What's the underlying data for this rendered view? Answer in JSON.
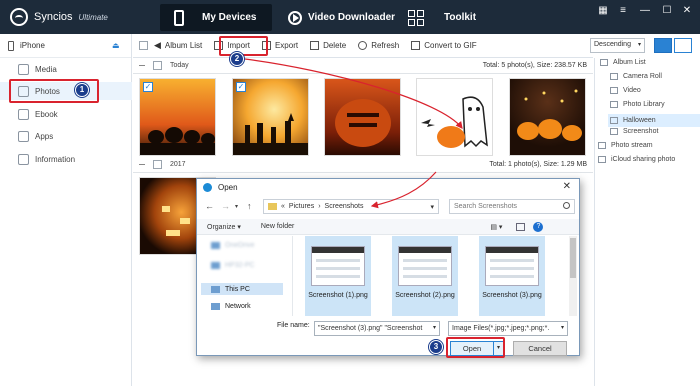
{
  "app": {
    "name": "Syncios",
    "edition": "Ultimate"
  },
  "nav": {
    "devices": "My Devices",
    "video": "Video Downloader",
    "toolkit": "Toolkit"
  },
  "window_controls": [
    "▦",
    "≡",
    "—",
    "☐",
    "✕"
  ],
  "device": {
    "name": "iPhone",
    "eject": "⏏"
  },
  "sidebar": {
    "items": [
      {
        "label": "Media",
        "icon": "media-icon"
      },
      {
        "label": "Photos",
        "icon": "photos-icon"
      },
      {
        "label": "Ebook",
        "icon": "ebook-icon"
      },
      {
        "label": "Apps",
        "icon": "apps-icon"
      },
      {
        "label": "Information",
        "icon": "info-icon"
      }
    ]
  },
  "toolbar": {
    "album_list": "Album List",
    "import": "Import",
    "export": "Export",
    "delete": "Delete",
    "refresh": "Refresh",
    "convert": "Convert to GIF",
    "sort": "Descending",
    "sort_arrow": "▾"
  },
  "groups": [
    {
      "label": "Today",
      "total": "Total: 5 photo(s), Size: 238.57 KB"
    },
    {
      "label": "2017",
      "total": "Total: 1 photo(s), Size: 1.29 MB"
    }
  ],
  "thumb_check": "✓",
  "right_panel": {
    "album_list": "Album List",
    "items": [
      "Camera Roll",
      "Video",
      "Photo Library",
      "Halloween",
      "Screenshot"
    ],
    "photo_stream": "Photo stream",
    "icloud": "iCloud sharing photo"
  },
  "badges": [
    "1",
    "2",
    "3"
  ],
  "dialog": {
    "title": "Open",
    "close": "✕",
    "path": [
      "«",
      "Pictures",
      "›",
      "Screenshots"
    ],
    "path_arrow": "▾",
    "search_placeholder": "Search Screenshots",
    "organize": "Organize ▾",
    "new_folder": "New folder",
    "view_icon": "▤ ▾",
    "help": "?",
    "nav_items": [
      "OneDrive",
      "HP32-PC",
      "This PC",
      "Network"
    ],
    "files": [
      "Screenshot (1).png",
      "Screenshot (2).png",
      "Screenshot (3).png"
    ],
    "file_name_label": "File name:",
    "file_name_value": "\"Screenshot (3).png\" \"Screenshot",
    "file_type": "Image Files(*.jpg;*.jpeg;*.png;*.",
    "dropdown_arrow": "▾",
    "open": "Open",
    "cancel": "Cancel"
  },
  "colors": {
    "titlebar": "#1d2b3a",
    "accent": "#2a82d3",
    "highlight": "#d9232e",
    "badge": "#1b3d8c"
  }
}
